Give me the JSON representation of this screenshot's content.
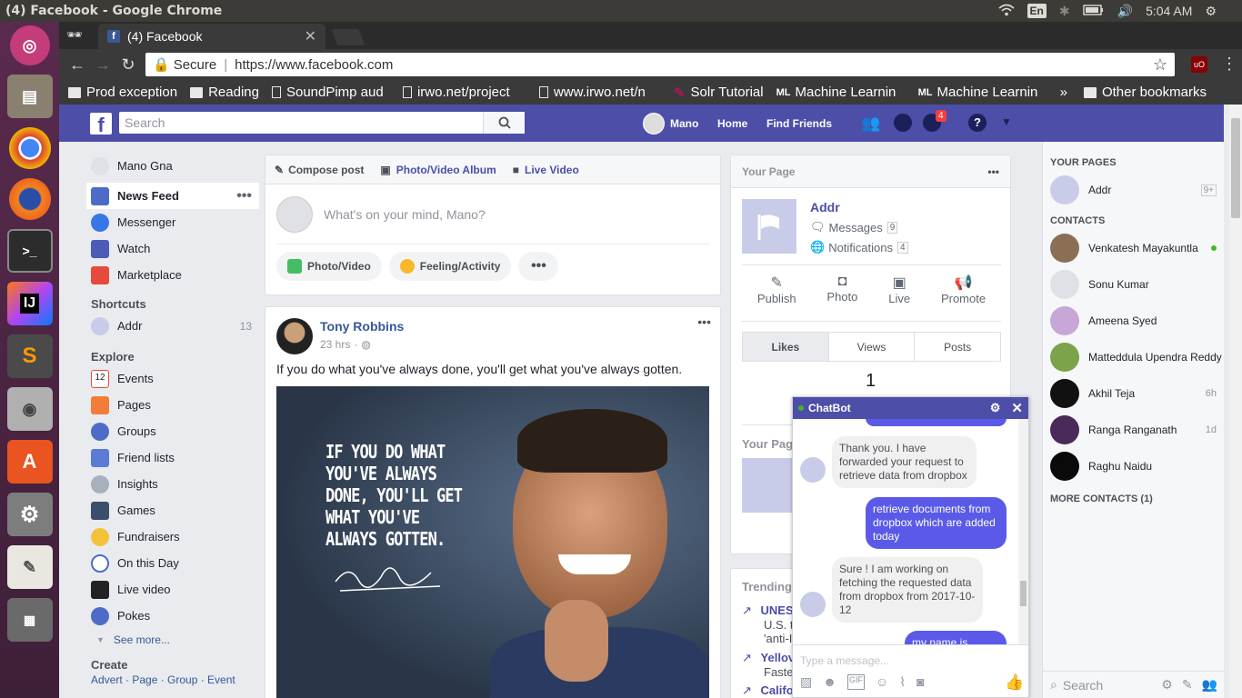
{
  "os": {
    "window_title": "(4) Facebook - Google Chrome",
    "keyboard_layout": "En",
    "clock": "5:04 AM"
  },
  "browser": {
    "tab_title": "(4) Facebook",
    "security_label": "Secure",
    "url": "https://www.facebook.com",
    "bookmarks": [
      {
        "label": "Prod exception",
        "type": "folder"
      },
      {
        "label": "Reading",
        "type": "folder"
      },
      {
        "label": "SoundPimp aud",
        "type": "page"
      },
      {
        "label": "irwo.net/project",
        "type": "page"
      },
      {
        "label": "www.irwo.net/n",
        "type": "page"
      },
      {
        "label": "Solr Tutorial",
        "type": "page"
      },
      {
        "label": "Machine Learnin",
        "type": "page"
      },
      {
        "label": "Machine Learnin",
        "type": "page"
      }
    ],
    "bookmarks_overflow": "»",
    "other_bookmarks": "Other bookmarks"
  },
  "fb_header": {
    "search_placeholder": "Search",
    "user_name": "Mano",
    "home": "Home",
    "find_friends": "Find Friends",
    "notification_count": "4"
  },
  "left_nav": {
    "profile": "Mano Gna",
    "main": [
      {
        "label": "News Feed",
        "active": true
      },
      {
        "label": "Messenger"
      },
      {
        "label": "Watch"
      },
      {
        "label": "Marketplace"
      }
    ],
    "shortcuts_head": "Shortcuts",
    "shortcuts": [
      {
        "label": "Addr",
        "count": "13"
      }
    ],
    "explore_head": "Explore",
    "explore": [
      {
        "label": "Events",
        "icon": "calendar-icon"
      },
      {
        "label": "Pages",
        "icon": "flag-icon"
      },
      {
        "label": "Groups",
        "icon": "groups-icon"
      },
      {
        "label": "Friend lists",
        "icon": "friend-list-icon"
      },
      {
        "label": "Insights",
        "icon": "insights-icon"
      },
      {
        "label": "Games",
        "icon": "games-icon"
      },
      {
        "label": "Fundraisers",
        "icon": "fundraiser-icon"
      },
      {
        "label": "On this Day",
        "icon": "clock-icon"
      },
      {
        "label": "Live video",
        "icon": "video-icon"
      },
      {
        "label": "Pokes",
        "icon": "poke-icon"
      }
    ],
    "see_more": "See more...",
    "create_head": "Create",
    "create_links": "Advert · Page · Group · Event"
  },
  "composer": {
    "tabs": [
      "Compose post",
      "Photo/Video Album",
      "Live Video"
    ],
    "placeholder": "What's on your mind, Mano?",
    "actions": [
      "Photo/Video",
      "Feeling/Activity"
    ]
  },
  "post": {
    "author": "Tony Robbins",
    "time": "23 hrs",
    "text": "If you do what you've always done, you'll get what you've always gotten.",
    "image_quote": [
      "IF YOU DO WHAT",
      "YOU'VE ALWAYS",
      "DONE, YOU'LL GET",
      "WHAT YOU'VE",
      "ALWAYS GOTTEN."
    ]
  },
  "your_page": {
    "title": "Your Page",
    "page_name": "Addr",
    "messages_label": "Messages",
    "messages_count": "9",
    "notifications_label": "Notifications",
    "notifications_count": "4",
    "actions": [
      "Publish",
      "Photo",
      "Live",
      "Promote"
    ],
    "tabs": [
      "Likes",
      "Views",
      "Posts"
    ],
    "likes_value": "1",
    "second_title": "Your Pag"
  },
  "trending": {
    "title": "Trending",
    "items": [
      {
        "head": "UNES",
        "sub": "U.S. t",
        "sub2": "'anti-I"
      },
      {
        "head": "Yellov",
        "sub": "Faste"
      },
      {
        "head": "Califo"
      }
    ]
  },
  "chatbot": {
    "title": "ChatBot",
    "messages": [
      {
        "from": "bot",
        "text": "Thank you. I have forwarded your request to retrieve data from dropbox"
      },
      {
        "from": "me",
        "text": "retrieve documents from dropbox which are added today"
      },
      {
        "from": "bot",
        "text": "Sure ! I am working on fetching the requested data from dropbox from 2017-10-12"
      },
      {
        "from": "me",
        "text": "my name is sudha"
      }
    ],
    "input_placeholder": "Type a message..."
  },
  "chat_sidebar": {
    "pages_head": "YOUR PAGES",
    "page": {
      "name": "Addr",
      "badge": "9+"
    },
    "contacts_head": "CONTACTS",
    "contacts": [
      {
        "name": "Venkatesh Mayakuntla",
        "meta": "",
        "online": true,
        "color": "#8a6f55"
      },
      {
        "name": "Sonu Kumar",
        "meta": "",
        "online": false,
        "color": "#dfe1e6"
      },
      {
        "name": "Ameena Syed",
        "meta": "",
        "online": false,
        "color": "#c8a7d8"
      },
      {
        "name": "Matteddula Upendra Reddy",
        "meta": "",
        "online": false,
        "color": "#7aa34a"
      },
      {
        "name": "Akhil Teja",
        "meta": "6h",
        "online": false,
        "color": "#111111"
      },
      {
        "name": "Ranga Ranganath",
        "meta": "1d",
        "online": false,
        "color": "#4a2a5a"
      },
      {
        "name": "Raghu Naidu",
        "meta": "",
        "online": false,
        "color": "#0a0a0a"
      }
    ],
    "more_contacts": "MORE CONTACTS (1)",
    "search_placeholder": "Search"
  },
  "colors": {
    "fb_blue": "#4c4ea8",
    "link_blue": "#365899",
    "online_green": "#42b72a",
    "notif_red": "#fa3e3e"
  }
}
